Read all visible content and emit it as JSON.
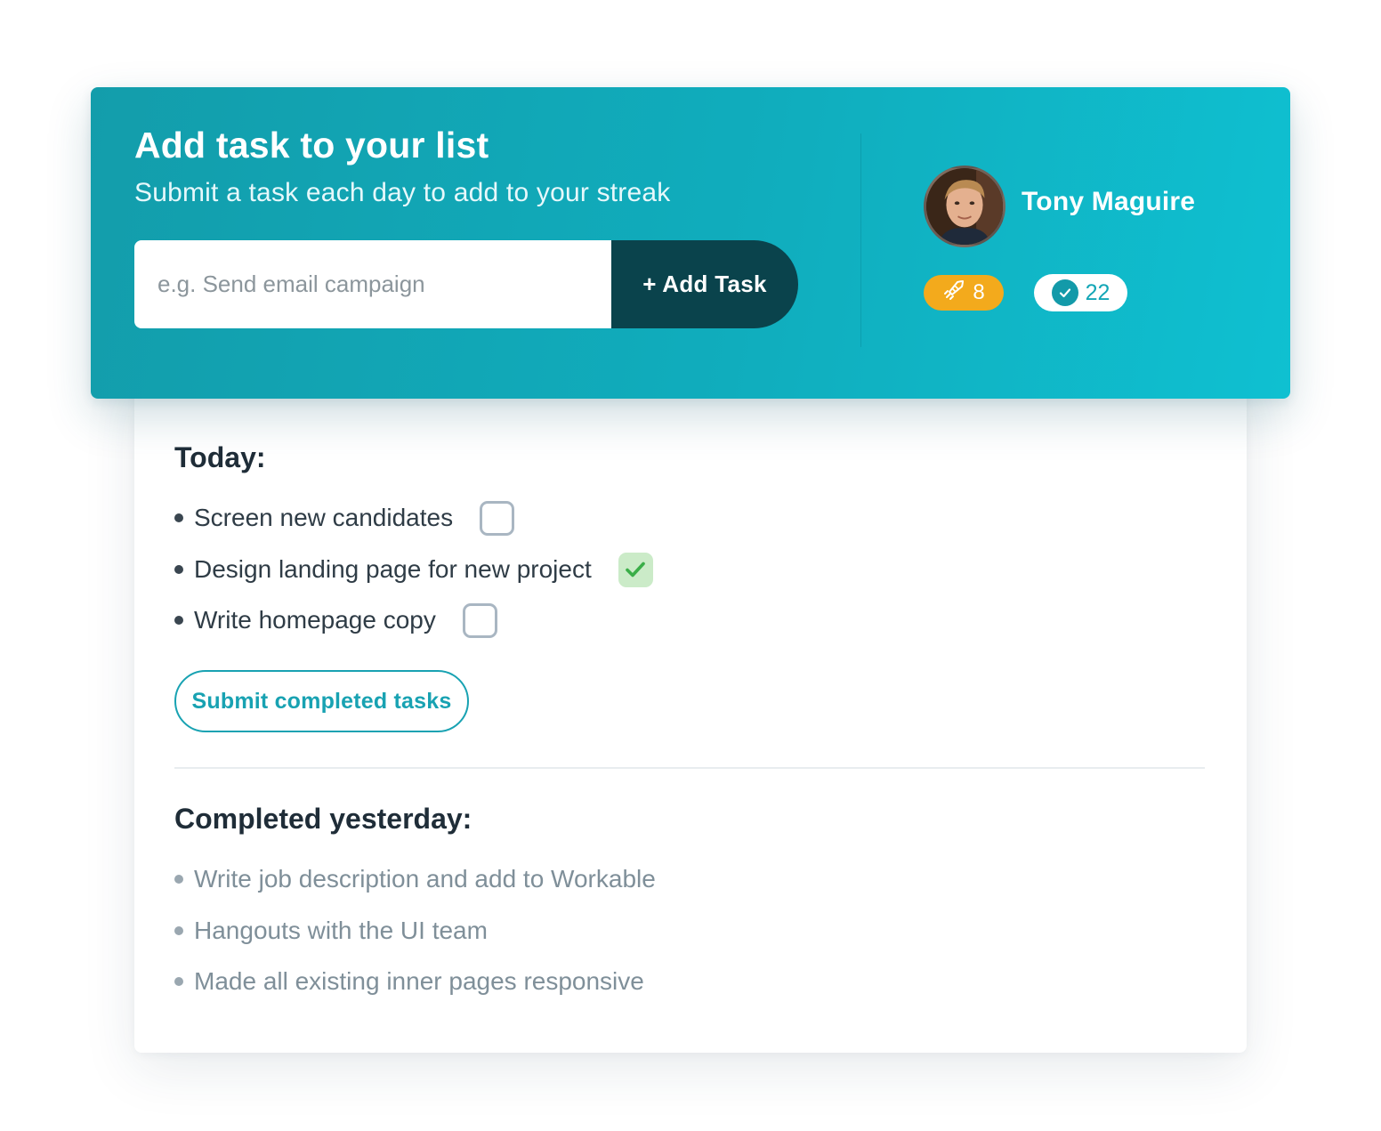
{
  "header": {
    "title": "Add task to your list",
    "subtitle": "Submit a task each day to add to your streak",
    "input_placeholder": "e.g. Send email campaign",
    "add_button_label": "+ Add Task"
  },
  "user": {
    "name": "Tony Maguire",
    "streak_count": "8",
    "completed_count": "22"
  },
  "today": {
    "heading": "Today:",
    "tasks": [
      {
        "label": "Screen new candidates",
        "checked": false
      },
      {
        "label": "Design landing page for new project",
        "checked": true
      },
      {
        "label": "Write homepage copy",
        "checked": false
      }
    ],
    "submit_label": "Submit completed tasks"
  },
  "yesterday": {
    "heading": "Completed yesterday:",
    "items": [
      "Write job description and add to Workable",
      "Hangouts with the UI team",
      "Made all existing inner pages responsive"
    ]
  },
  "colors": {
    "banner_teal": "#10adbd",
    "button_dark": "#0a434c",
    "streak_orange": "#f3aa1c",
    "accent_teal": "#18a2b2",
    "check_green": "#3aae48"
  },
  "icons": {
    "streak": "rocket-icon",
    "completed": "check-circle-icon",
    "checkbox_checked": "checkmark-icon"
  }
}
